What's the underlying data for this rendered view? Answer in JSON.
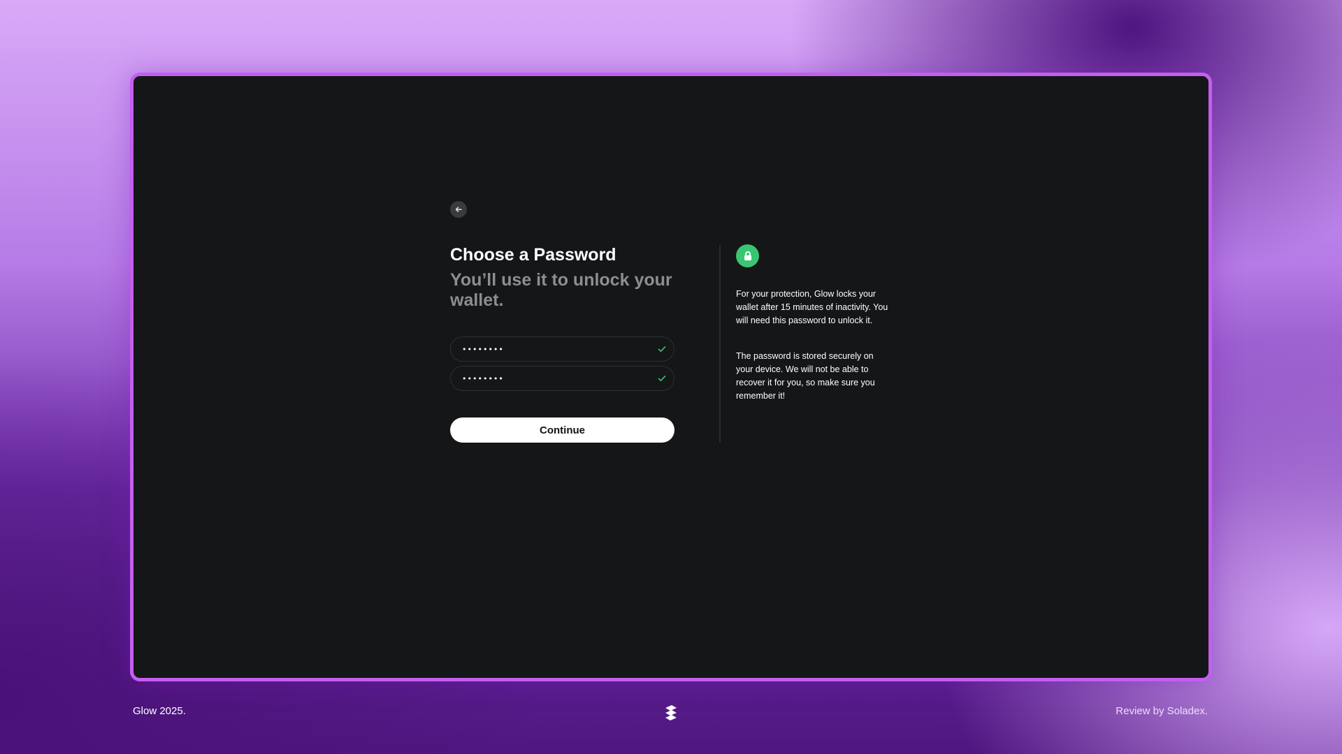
{
  "colors": {
    "frame_border": "#c45ef0",
    "panel_background": "#151618",
    "accent_green": "#3bc573",
    "subtitle_gray": "#8d8e92"
  },
  "form": {
    "back_icon": "arrow-left-icon",
    "title": "Choose a Password",
    "subtitle": "You’ll use it to unlock your wallet.",
    "password_value": "••••••••",
    "confirm_value": "••••••••",
    "valid_icon": "check-icon",
    "continue_label": "Continue"
  },
  "info": {
    "icon": "lock-icon",
    "paragraph1": "For your protection, Glow locks your wallet after 15 minutes of inactivity. You will need this password to unlock it.",
    "paragraph2": "The password is stored securely on your device. We will not be able to recover it for you, so make sure you remember it!"
  },
  "footer": {
    "left": "Glow 2025.",
    "logo_icon": "soladex-logo-icon",
    "right": "Review by Soladex."
  }
}
